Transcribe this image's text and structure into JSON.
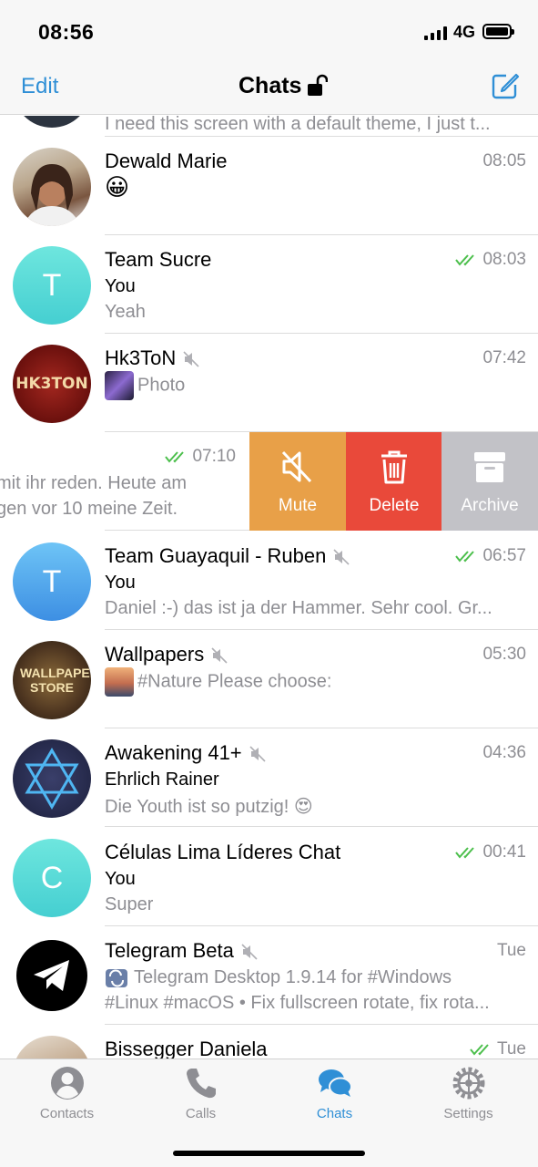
{
  "status_bar": {
    "time": "08:56",
    "network": "4G",
    "icons": [
      "signal-icon",
      "battery-icon"
    ]
  },
  "nav": {
    "edit_label": "Edit",
    "title": "Chats",
    "icons": [
      "lock-icon",
      "compose-icon"
    ]
  },
  "colors": {
    "accent": "#2f8fd6",
    "read_check": "#4cbf4c",
    "mute": "#e8a048",
    "delete": "#e9493a",
    "archive": "#c2c2c7",
    "separator": "#dcdcdc",
    "secondary_text": "#8e8e93"
  },
  "chats": [
    {
      "name": "",
      "time": "",
      "line1": "I need this screen with a default theme, I just t...",
      "line2": ""
    },
    {
      "name": "Dewald Marie",
      "time": "08:05",
      "line1": "😀",
      "line2": "",
      "muted": false,
      "read": false
    },
    {
      "name": "Team Sucre",
      "time": "08:03",
      "line1": "You",
      "line2": "Yeah",
      "muted": false,
      "read": true,
      "avatar_letter": "T"
    },
    {
      "name": "Hk3ToN",
      "time": "07:42",
      "line1": "Photo",
      "line2": "",
      "muted": true,
      "read": false,
      "avatar_text": "HK3TON"
    },
    {
      "name": "Team Guayaquil - Ruben",
      "time": "06:57",
      "line1": "You",
      "line2": "Daniel :-) das ist ja der Hammer. Sehr cool. Gr...",
      "muted": true,
      "read": true,
      "avatar_letter": "T"
    },
    {
      "name": "Wallpapers",
      "time": "05:30",
      "line1": "#Nature Please choose:",
      "line2": "",
      "muted": true,
      "read": false,
      "avatar_text": "WALLPAPERS STORE"
    },
    {
      "name": "Awakening 41+",
      "time": "04:36",
      "line1": "Ehrlich Rainer",
      "line2": "Die Youth ist so putzig! 😍",
      "muted": true,
      "read": false
    },
    {
      "name": "Células Lima Líderes Chat",
      "time": "00:41",
      "line1": "You",
      "line2": "Super",
      "muted": false,
      "read": true,
      "avatar_letter": "C"
    },
    {
      "name": "Telegram Beta",
      "time": "Tue",
      "line1": "Telegram Desktop 1.9.14 for #Windows",
      "line2": "#Linux #macOS • Fix fullscreen rotate, fix rota...",
      "muted": true,
      "read": false
    },
    {
      "name": "Bissegger Daniela",
      "time": "Tue",
      "line1": "",
      "line2": "",
      "muted": false,
      "read": true
    }
  ],
  "swiped_chat": {
    "time": "07:10",
    "line1": "mit ihr reden. Heute am",
    "line2": "gen vor 10 meine Zeit.",
    "actions": [
      {
        "label": "Mute",
        "icon": "mute-icon",
        "color": "#e8a048"
      },
      {
        "label": "Delete",
        "icon": "trash-icon",
        "color": "#e9493a"
      },
      {
        "label": "Archive",
        "icon": "archive-icon",
        "color": "#c2c2c7"
      }
    ]
  },
  "tabs": [
    {
      "label": "Contacts",
      "icon": "contacts-icon",
      "active": false
    },
    {
      "label": "Calls",
      "icon": "phone-icon",
      "active": false
    },
    {
      "label": "Chats",
      "icon": "chats-icon",
      "active": true
    },
    {
      "label": "Settings",
      "icon": "settings-icon",
      "active": false
    }
  ]
}
